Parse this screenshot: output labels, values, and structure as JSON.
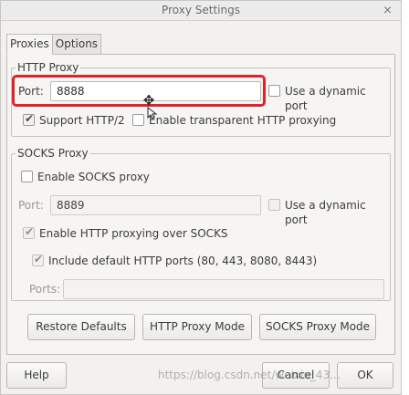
{
  "window": {
    "title": "Proxy Settings",
    "close_glyph": "×"
  },
  "tabs": [
    {
      "label": "Proxies",
      "active": true
    },
    {
      "label": "Options",
      "active": false
    }
  ],
  "http_proxy": {
    "title": "HTTP Proxy",
    "port_label": "Port:",
    "port_value": "8888",
    "dynamic_port_label": "Use a dynamic port",
    "dynamic_port_checked": false,
    "support_http2_label": "Support HTTP/2",
    "support_http2_checked": true,
    "transparent_label": "Enable transparent HTTP proxying",
    "transparent_checked": false
  },
  "socks_proxy": {
    "title": "SOCKS Proxy",
    "enable_label": "Enable SOCKS proxy",
    "enable_checked": false,
    "port_label": "Port:",
    "port_value": "8889",
    "dynamic_port_label": "Use a dynamic port",
    "dynamic_port_checked": false,
    "http_over_socks_label": "Enable HTTP proxying over SOCKS",
    "http_over_socks_checked": true,
    "include_default_ports_label": "Include default HTTP ports (80, 443, 8080, 8443)",
    "include_default_ports_checked": true,
    "ports_label": "Ports:",
    "ports_value": ""
  },
  "mode_buttons": {
    "restore_defaults": "Restore Defaults",
    "http_proxy_mode": "HTTP Proxy Mode",
    "socks_proxy_mode": "SOCKS Proxy Mode"
  },
  "footer": {
    "help": "Help",
    "cancel": "Cancel",
    "ok": "OK"
  },
  "watermark": "https://blog.csdn.net/weixin_43...",
  "colors": {
    "highlight": "#e0222a",
    "window_bg": "#f2f1f0"
  },
  "icons": {
    "tick": "✔",
    "move_cursor": "✥"
  }
}
